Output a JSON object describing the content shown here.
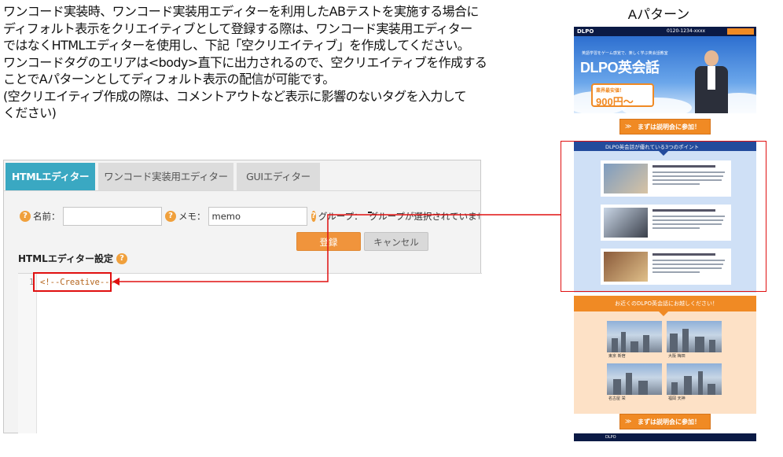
{
  "description": {
    "lines": [
      "ワンコード実装時、ワンコード実装用エディターを利用したABテストを実施する場合に",
      "ディフォルト表示をクリエイティブとして登録する際は、ワンコード実装用エディター",
      "ではなくHTMLエディターを使用し、下記「空クリエイティブ」を作成してください。",
      "ワンコードタグのエリアは<body>直下に出力されるので、空クリエイティブを作成する",
      "ことでAパターンとしてディフォルト表示の配信が可能です。",
      "(空クリエイティブ作成の際は、コメントアウトなど表示に影響のないタグを入力して",
      "ください)"
    ]
  },
  "editor": {
    "tabs": [
      "HTMLエディター",
      "ワンコード実装用エディター",
      "GUIエディター"
    ],
    "active_tab": 0,
    "name_label": "名前：",
    "name_value": "",
    "memo_label": "メモ：",
    "memo_value": "memo",
    "group_label": "グループ：",
    "group_value": "グループが選択されていません",
    "register_button": "登録",
    "cancel_button": "キャンセル",
    "settings_title": "HTMLエディター設定",
    "help_glyph": "?",
    "line_number": "1",
    "code": "<!--Creative-->"
  },
  "preview": {
    "title": "Aパターン",
    "nav_logo": "DLPO",
    "nav_tel": "0120-1234-xxxx",
    "hero_sub": "英語学習をゲーム感覚で、楽しく学ぶ英会話教室",
    "hero_title": "DLPO英会話",
    "badge_line1": "業界最安値！",
    "badge_line2": "900円〜",
    "cta_label": "まずは説明会に参加！",
    "cta_arrows": "≫",
    "points_title": "DLPO英会話が優れている3つのポイント",
    "locations_title": "お近くのDLPO英会話にお越しください！",
    "cities": [
      "東京 新宿",
      "大阪 梅田",
      "名古屋 栄",
      "福岡 天神"
    ],
    "footer": "DLPO"
  },
  "colors": {
    "tab_active": "#3aa8c2",
    "accent_orange": "#f0943c",
    "annotation_red": "#e01010",
    "nav_navy": "#0b1a45"
  }
}
